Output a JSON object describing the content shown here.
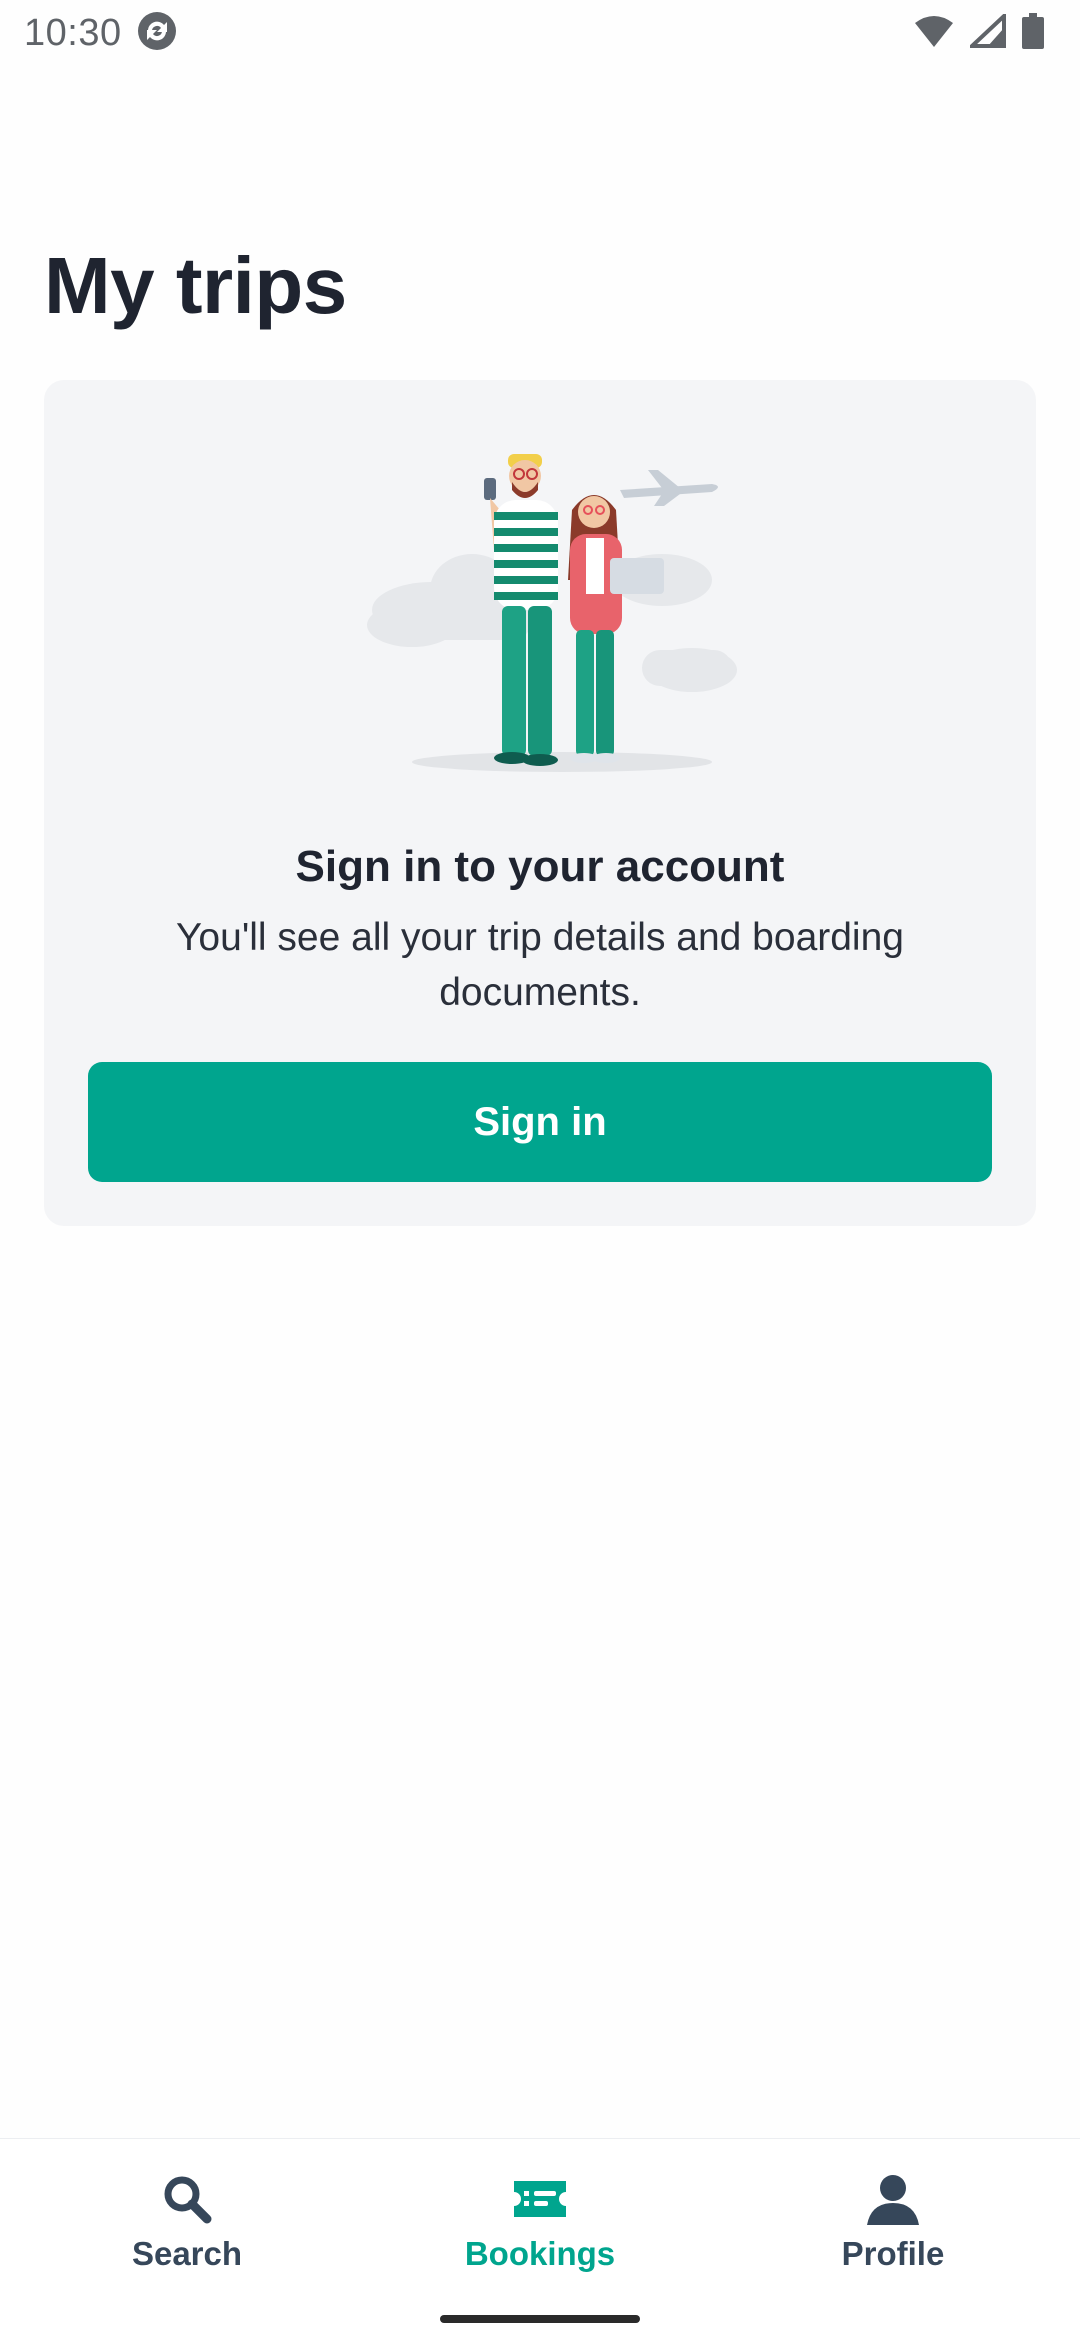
{
  "status_bar": {
    "time": "10:30",
    "icons": [
      "sync-app-icon",
      "wifi-icon",
      "signal-icon",
      "battery-icon"
    ]
  },
  "page": {
    "title": "My trips"
  },
  "signin_card": {
    "illustration": "couple-travel-illustration",
    "heading": "Sign in to your account",
    "body": "You'll see all your trip details and boarding documents.",
    "button_label": "Sign in"
  },
  "bottom_nav": {
    "items": [
      {
        "label": "Search",
        "icon": "search-icon",
        "active": false
      },
      {
        "label": "Bookings",
        "icon": "ticket-icon",
        "active": true
      },
      {
        "label": "Profile",
        "icon": "person-icon",
        "active": false
      }
    ]
  },
  "colors": {
    "accent": "#00a58e",
    "card_background": "#f4f5f7",
    "text_primary": "#1f2430",
    "nav_inactive": "#36475a"
  }
}
